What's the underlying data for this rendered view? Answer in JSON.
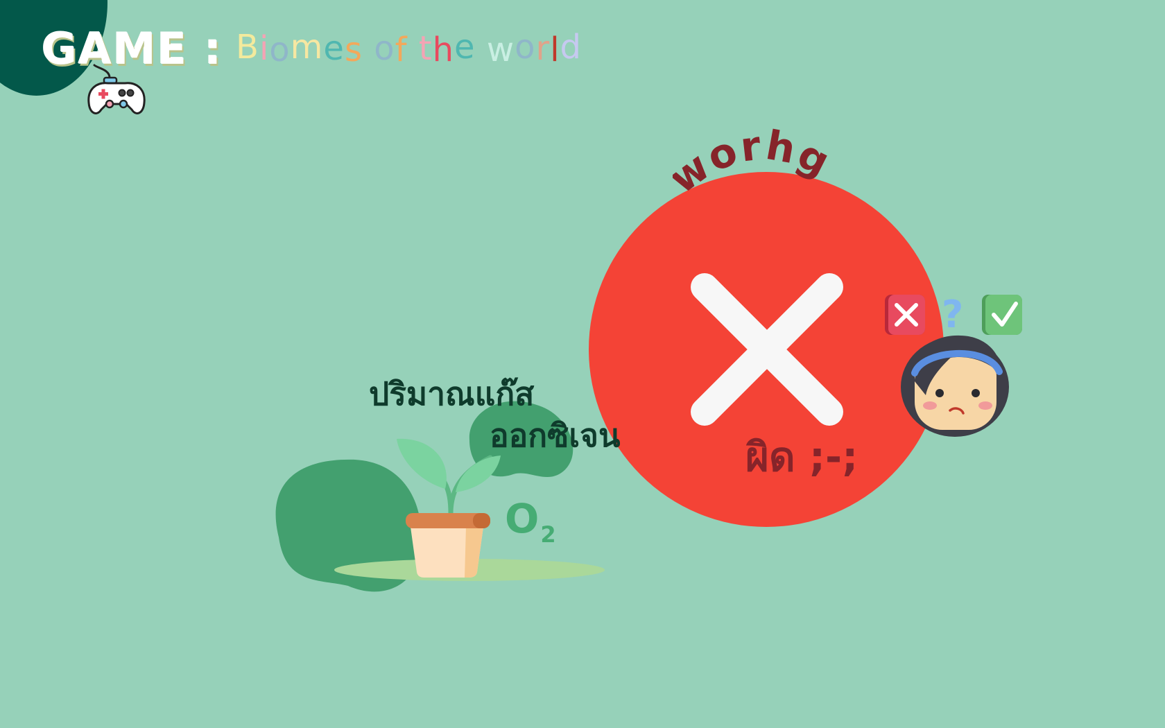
{
  "header": {
    "game_label": "GAME :",
    "subtitle_letters": [
      {
        "ch": "B",
        "color": "#f3ea9d"
      },
      {
        "ch": "i",
        "color": "#f4a3b4"
      },
      {
        "ch": "o",
        "color": "#8fb6c9"
      },
      {
        "ch": "m",
        "color": "#f6e7a2"
      },
      {
        "ch": "e",
        "color": "#4fb7b0"
      },
      {
        "ch": "s",
        "color": "#f3a85b"
      },
      {
        "ch": " ",
        "color": "#ffffff"
      },
      {
        "ch": "o",
        "color": "#8fb6c9"
      },
      {
        "ch": "f",
        "color": "#f3a85b"
      },
      {
        "ch": " ",
        "color": "#ffffff"
      },
      {
        "ch": "t",
        "color": "#f4a3b4"
      },
      {
        "ch": "h",
        "color": "#e84a5f"
      },
      {
        "ch": "e",
        "color": "#4fb7b0"
      },
      {
        "ch": " ",
        "color": "#ffffff"
      },
      {
        "ch": "w",
        "color": "#c9efe3"
      },
      {
        "ch": "o",
        "color": "#8fb6c9"
      },
      {
        "ch": "r",
        "color": "#e0a38a"
      },
      {
        "ch": "l",
        "color": "#c0392b"
      },
      {
        "ch": "d",
        "color": "#c6c9f0"
      }
    ],
    "icon": "gamepad-icon"
  },
  "result": {
    "arc_word": "worhg",
    "thai_text": "ผิด ;-;",
    "mark_icon": "cross-icon",
    "circle_color": "#f44336",
    "character_icon": "confused-girl-quiz-icon"
  },
  "prompt": {
    "line1": "ปริมาณแก๊ส",
    "line2": "ออกซิเจน",
    "o2_main": "O",
    "o2_sub": "2",
    "icon": "potted-plant-icon"
  },
  "colors": {
    "background": "#96d1b9",
    "corner": "#03584a",
    "dark_green_blob": "#43a06f",
    "dark_text": "#0f3b2c",
    "wrong_text": "#86242a"
  }
}
